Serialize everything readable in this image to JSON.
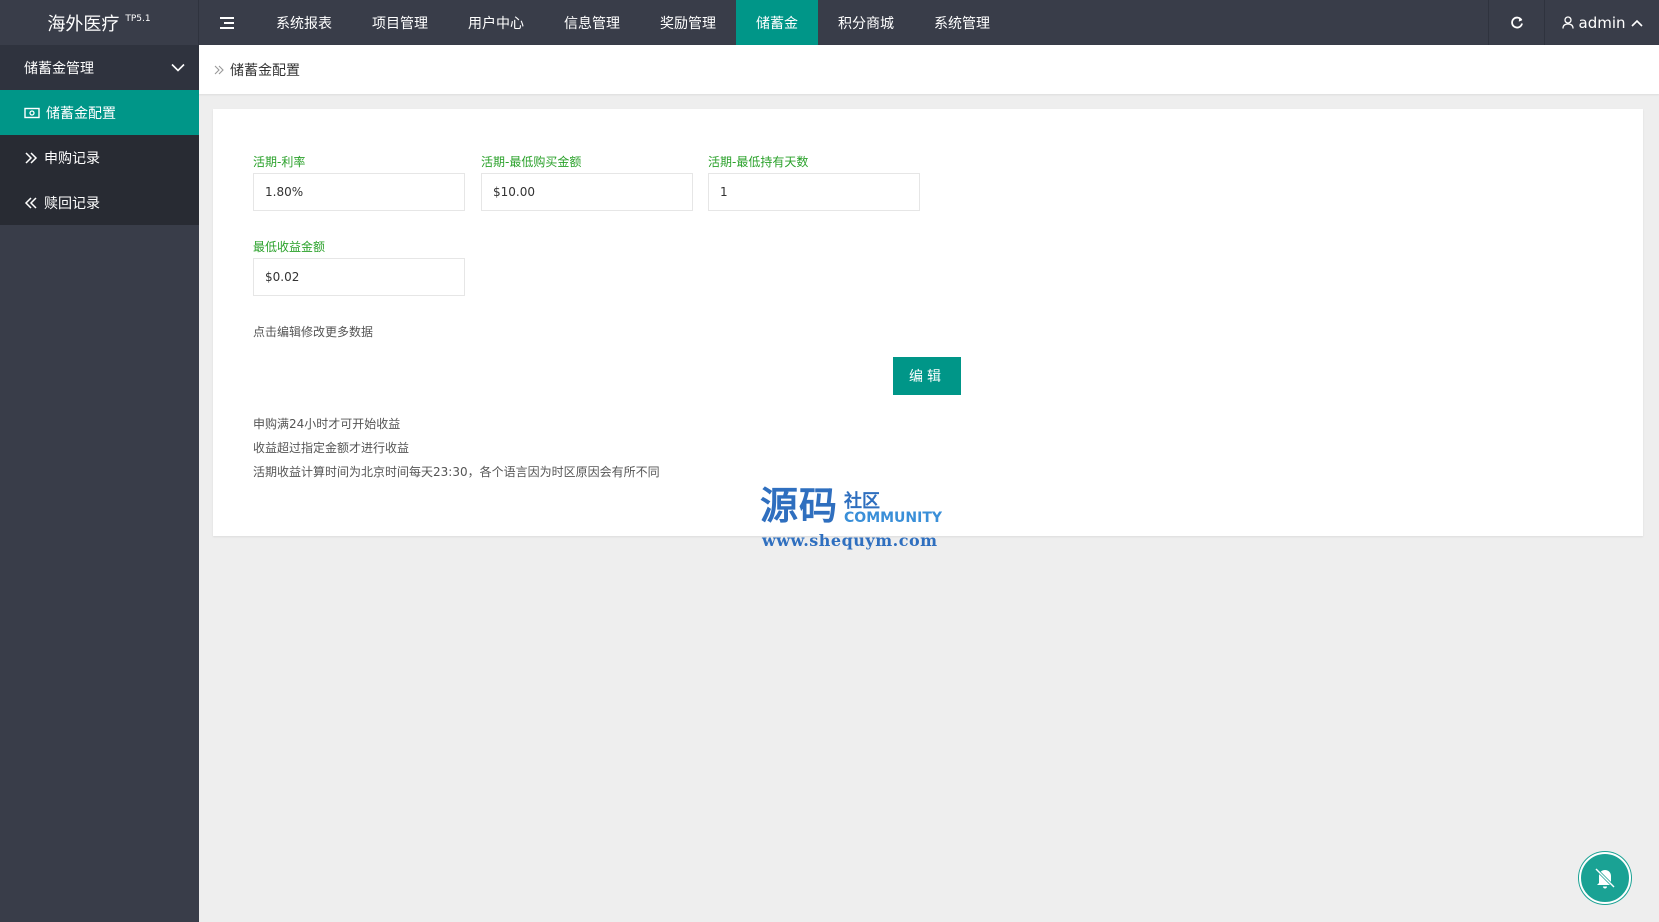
{
  "header": {
    "logo_title": "海外医疗",
    "logo_sup": "TP5.1",
    "nav": [
      {
        "label": "系统报表",
        "active": false
      },
      {
        "label": "项目管理",
        "active": false
      },
      {
        "label": "用户中心",
        "active": false
      },
      {
        "label": "信息管理",
        "active": false
      },
      {
        "label": "奖励管理",
        "active": false
      },
      {
        "label": "储蓄金",
        "active": true
      },
      {
        "label": "积分商城",
        "active": false
      },
      {
        "label": "系统管理",
        "active": false
      }
    ],
    "user": "admin"
  },
  "sidebar": {
    "group": "储蓄金管理",
    "items": [
      {
        "label": "储蓄金配置",
        "active": true
      },
      {
        "label": "申购记录",
        "active": false
      },
      {
        "label": "赎回记录",
        "active": false
      }
    ]
  },
  "breadcrumb": {
    "current": "储蓄金配置"
  },
  "form": {
    "rate": {
      "label": "活期-利率",
      "value": "1.80%"
    },
    "min_purchase": {
      "label": "活期-最低购买金额",
      "value": "$10.00"
    },
    "min_days": {
      "label": "活期-最低持有天数",
      "value": "1"
    },
    "min_income": {
      "label": "最低收益金额",
      "value": "$0.02"
    },
    "hint": "点击编辑修改更多数据",
    "edit_label": "编辑"
  },
  "notes": [
    "申购满24小时才可开始收益",
    "收益超过指定金额才进行收益",
    "活期收益计算时间为北京时间每天23:30，各个语言因为时区原因会有所不同"
  ],
  "watermark": {
    "big": "源码",
    "small": "社区",
    "community": "COMMUNITY",
    "url": "www.shequym.com"
  },
  "colors": {
    "accent": "#009688",
    "header_bg": "#393d49",
    "label_green": "#2aa12a"
  }
}
